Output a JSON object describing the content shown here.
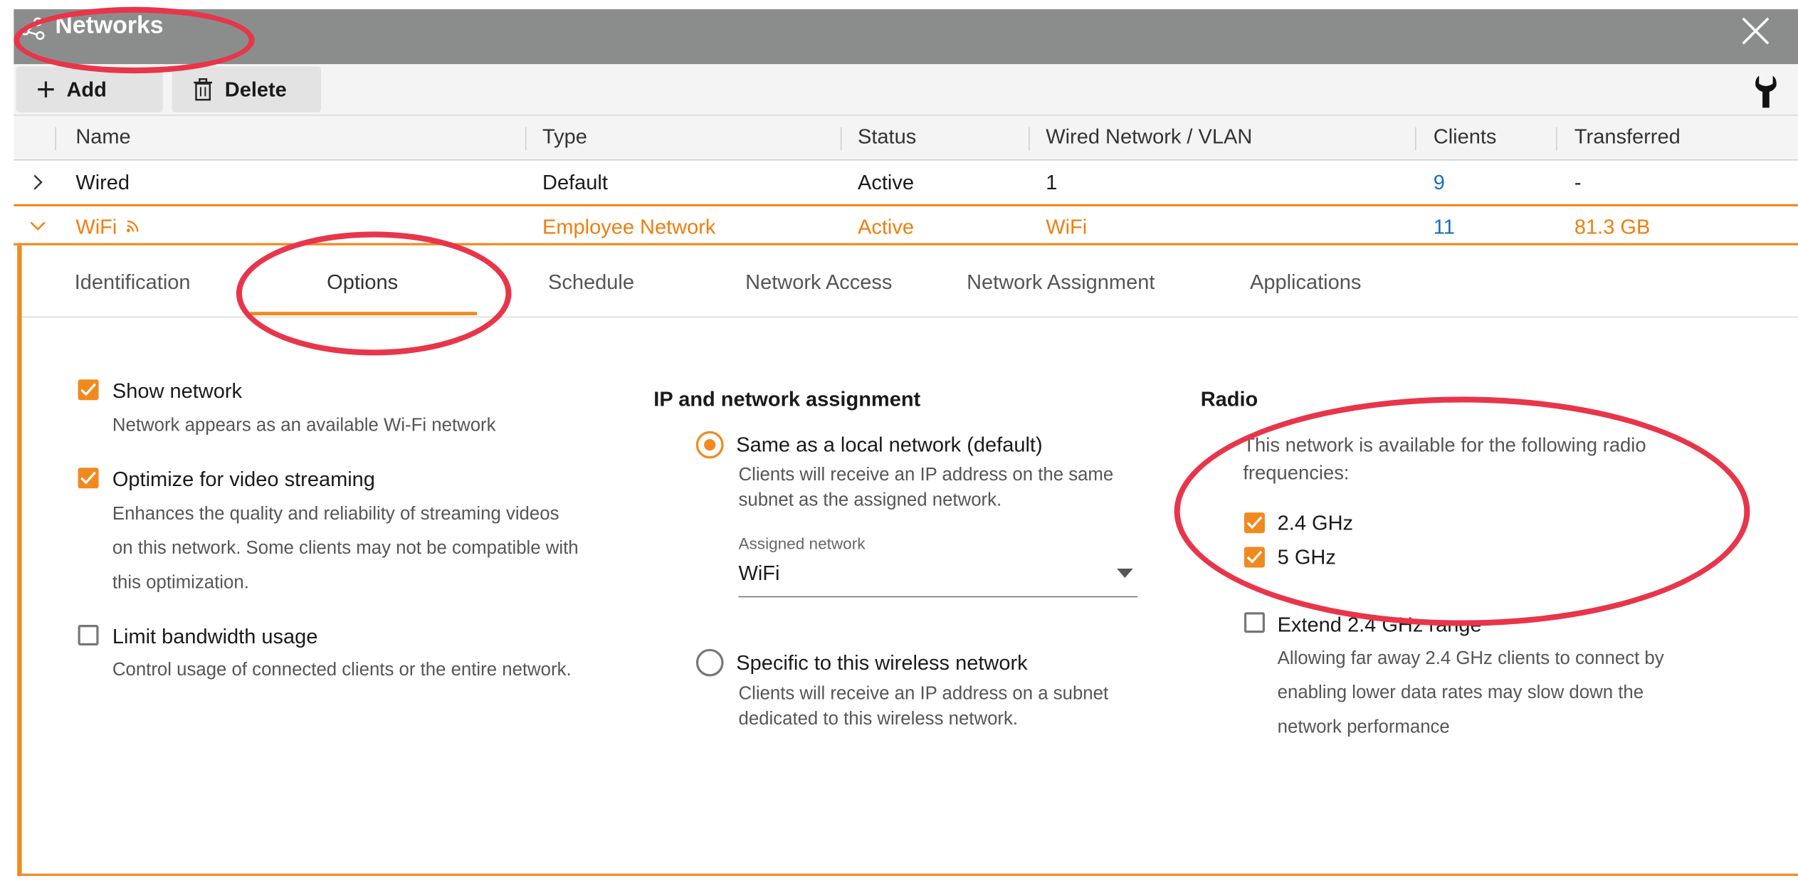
{
  "window": {
    "title": "Networks"
  },
  "toolbar": {
    "add_label": "Add",
    "delete_label": "Delete"
  },
  "table": {
    "columns": [
      "Name",
      "Type",
      "Status",
      "Wired Network / VLAN",
      "Clients",
      "Transferred"
    ],
    "rows": [
      {
        "name": "Wired",
        "type": "Default",
        "status": "Active",
        "vlan": "1",
        "clients": "9",
        "transferred": "-"
      },
      {
        "name": "WiFi",
        "type": "Employee Network",
        "status": "Active",
        "vlan": "WiFi",
        "clients": "11",
        "transferred": "81.3 GB"
      }
    ]
  },
  "tabs": [
    "Identification",
    "Options",
    "Schedule",
    "Network Access",
    "Network Assignment",
    "Applications"
  ],
  "active_tab": "Options",
  "options": {
    "show_network": {
      "label": "Show network",
      "desc": "Network appears as an available Wi-Fi network",
      "checked": true
    },
    "optimize_video": {
      "label": "Optimize for video streaming",
      "desc_lines": [
        "Enhances the quality and reliability of streaming videos",
        "on this network. Some clients may not be compatible with",
        "this optimization."
      ],
      "checked": true
    },
    "limit_bandwidth": {
      "label": "Limit bandwidth usage",
      "desc": "Control usage of connected clients or the entire network.",
      "checked": false
    }
  },
  "ip_assignment": {
    "heading": "IP and network assignment",
    "same_local": {
      "label": "Same as a local network (default)",
      "desc_lines": [
        "Clients will receive an IP address on the same",
        "subnet as the assigned network."
      ],
      "selected": true
    },
    "assigned_network": {
      "label": "Assigned network",
      "value": "WiFi"
    },
    "specific": {
      "label": "Specific to this wireless network",
      "desc_lines": [
        "Clients will receive an IP address on a subnet",
        "dedicated to this wireless network."
      ],
      "selected": false
    }
  },
  "radio": {
    "heading": "Radio",
    "intro_lines": [
      "This network is available for the following radio",
      "frequencies:"
    ],
    "ghz24": {
      "label": "2.4 GHz",
      "checked": true
    },
    "ghz5": {
      "label": "5 GHz",
      "checked": true
    },
    "extend": {
      "label": "Extend 2.4 GHz range",
      "desc_lines": [
        "Allowing far away 2.4 GHz clients to connect by",
        "enabling lower data rates may slow down the",
        "network performance"
      ],
      "checked": false
    }
  },
  "colors": {
    "accent": "#f08a1e",
    "link": "#1b6fbf",
    "annotation": "#e8354a",
    "titlebar": "#8b8d8c"
  }
}
